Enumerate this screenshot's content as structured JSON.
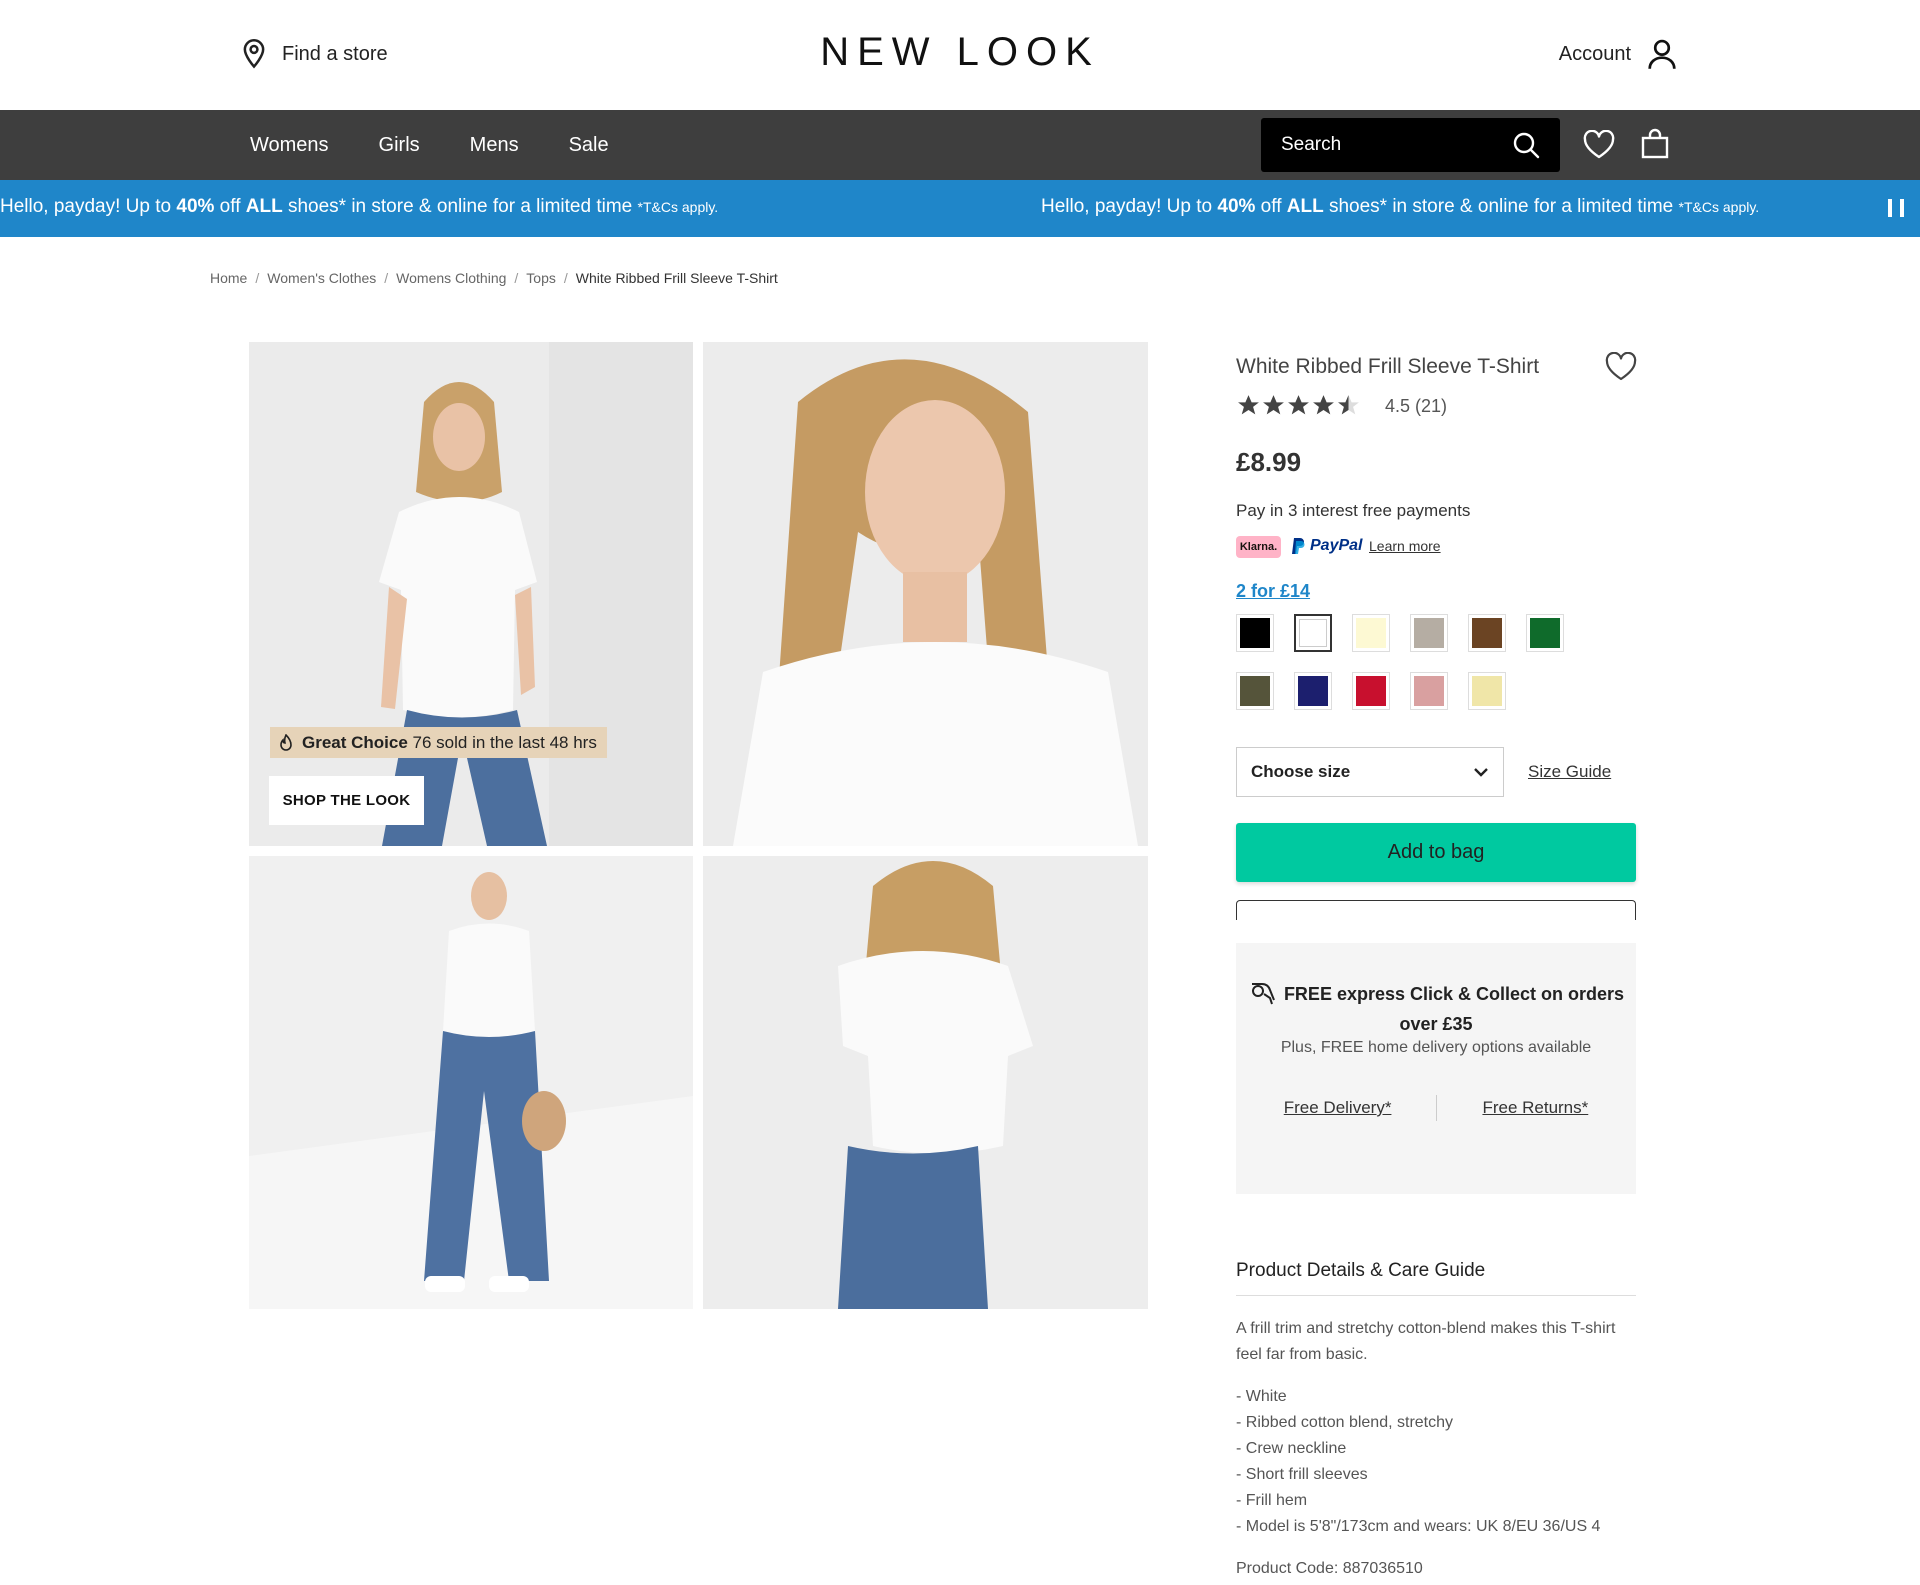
{
  "header": {
    "find_store": "Find a store",
    "logo": "NEW LOOK",
    "account": "Account"
  },
  "nav": {
    "items": [
      "Womens",
      "Girls",
      "Mens",
      "Sale"
    ],
    "search_placeholder": "Search"
  },
  "promo": {
    "prefix": "Hello, payday! Up to ",
    "percent": "40%",
    "off": " off ",
    "all": "ALL",
    "suffix": " shoes* in store & online for a limited time ",
    "tc": "*T&Cs apply."
  },
  "breadcrumb": [
    "Home",
    "Women's Clothes",
    "Womens Clothing",
    "Tops",
    "White Ribbed Frill Sleeve T-Shirt"
  ],
  "gallery": {
    "badge_strong": "Great Choice",
    "badge_text": " 76 sold in the last 48 hrs",
    "shop_the_look": "SHOP THE LOOK"
  },
  "product": {
    "title": "White Ribbed Frill Sleeve T-Shirt",
    "rating": 4.5,
    "rating_text": "4.5 (21)",
    "price": "£8.99",
    "pay_text": "Pay in 3 interest free payments",
    "klarna": "Klarna.",
    "paypal": "PayPal",
    "learn_more": "Learn more",
    "offer": "2 for £14",
    "swatches": [
      {
        "color": "#000000",
        "selected": false
      },
      {
        "color": "#ffffff",
        "selected": true
      },
      {
        "color": "#fdf9d3",
        "selected": false
      },
      {
        "color": "#b5ada3",
        "selected": false
      },
      {
        "color": "#6b4423",
        "selected": false
      },
      {
        "color": "#0f6b2b",
        "selected": false
      },
      {
        "color": "#55543a",
        "selected": false
      },
      {
        "color": "#1c1f6e",
        "selected": false
      },
      {
        "color": "#c8102e",
        "selected": false
      },
      {
        "color": "#d9a0a0",
        "selected": false
      },
      {
        "color": "#f0e6a8",
        "selected": false
      }
    ],
    "size_select": "Choose size",
    "size_guide": "Size Guide",
    "add_to_bag": "Add to bag"
  },
  "delivery": {
    "headline": "FREE express Click & Collect on orders over £35",
    "sub": "Plus, FREE home delivery options available",
    "free_delivery": "Free Delivery*",
    "free_returns": "Free Returns*"
  },
  "details": {
    "title": "Product Details & Care Guide",
    "description": "A frill trim and stretchy cotton-blend makes this T-shirt feel far from basic.",
    "bullets": [
      "- White",
      "- Ribbed cotton blend, stretchy",
      "- Crew neckline",
      "- Short frill sleeves",
      "- Frill hem",
      "- Model is 5'8\"/173cm and wears: UK 8/EU 36/US 4"
    ],
    "product_code": "Product Code: 887036510"
  },
  "colors": {
    "nav_bg": "#3e3e3e",
    "promo_bg": "#1f86c9",
    "add_to_bag": "#00c9a0",
    "badge_bg": "#e6d3b8"
  }
}
